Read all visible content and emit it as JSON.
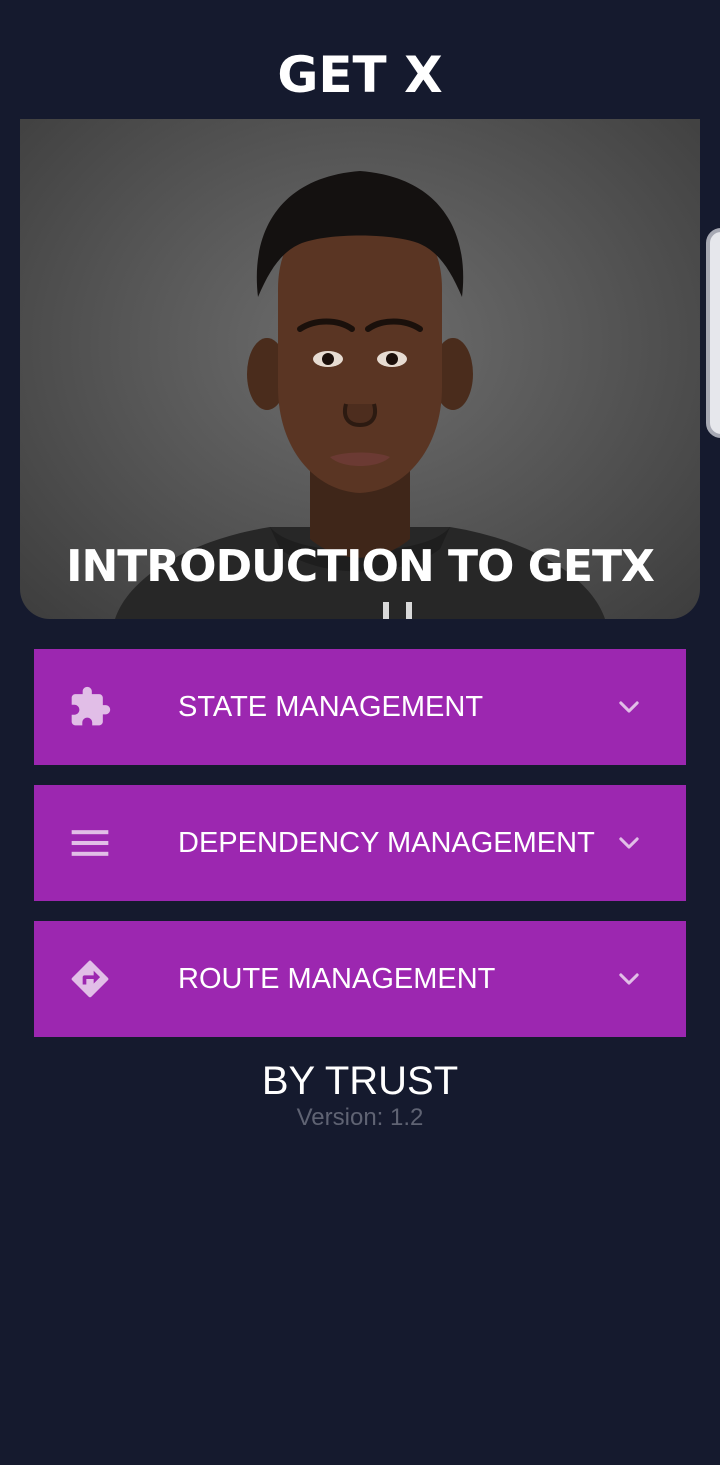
{
  "app": {
    "title": "GET X"
  },
  "hero": {
    "caption": "INTRODUCTION TO GETX",
    "image": "portrait-photo"
  },
  "menu": {
    "items": [
      {
        "label": "STATE MANAGEMENT",
        "icon": "puzzle-icon"
      },
      {
        "label": "DEPENDENCY MANAGEMENT",
        "icon": "menu-lines-icon"
      },
      {
        "label": "ROUTE MANAGEMENT",
        "icon": "directions-icon"
      }
    ]
  },
  "footer": {
    "author": "BY TRUST",
    "version": "Version: 1.2"
  },
  "colors": {
    "background": "#151a2e",
    "accent": "#9c27b0",
    "icon_tint": "#e1bee7",
    "muted_text": "#5f6373"
  }
}
